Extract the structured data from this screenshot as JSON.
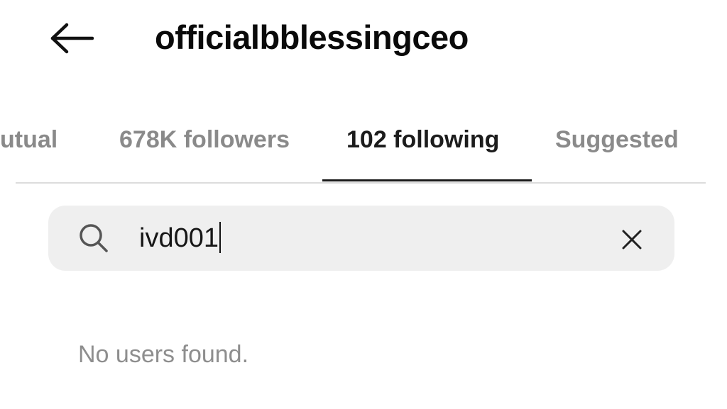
{
  "header": {
    "back_icon": "arrow-left-icon",
    "title": "officialbblessingceo"
  },
  "tabs": [
    {
      "id": "mutual",
      "label": "utual",
      "active": false
    },
    {
      "id": "followers",
      "label": "678K followers",
      "active": false
    },
    {
      "id": "following",
      "label": "102 following",
      "active": true
    },
    {
      "id": "suggested",
      "label": "Suggested",
      "active": false
    }
  ],
  "search": {
    "icon": "search-icon",
    "value": "ivd001",
    "clear_icon": "close-icon"
  },
  "results": {
    "empty_message": "No users found."
  },
  "colors": {
    "text_primary": "#0a0a0a",
    "text_secondary": "#8a8a8a",
    "search_bg": "#efefef",
    "divider": "#dcdcdc",
    "active_indicator": "#1a1a1a"
  }
}
